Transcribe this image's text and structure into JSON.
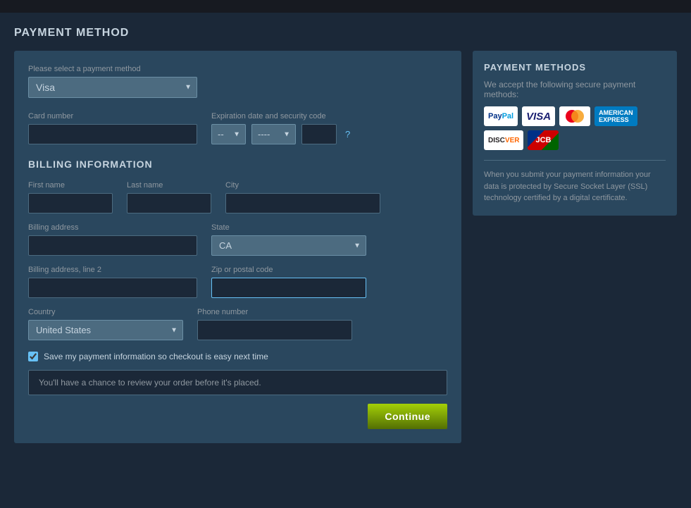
{
  "page": {
    "title": "PAYMENT METHOD",
    "top_bar_color": "#171a21"
  },
  "payment_method": {
    "label": "Please select a payment method",
    "options": [
      "Visa",
      "Mastercard",
      "PayPal",
      "American Express",
      "Discover"
    ],
    "selected": "Visa"
  },
  "card_fields": {
    "card_number_label": "Card number",
    "card_number_placeholder": "",
    "expiry_label": "Expiration date and security code",
    "expiry_month_default": "--",
    "expiry_year_default": "----",
    "cvv_placeholder": "",
    "cvv_hint": "?"
  },
  "billing": {
    "section_title": "BILLING INFORMATION",
    "first_name_label": "First name",
    "last_name_label": "Last name",
    "city_label": "City",
    "billing_address_label": "Billing address",
    "state_label": "State",
    "state_value": "CA",
    "billing_address2_label": "Billing address, line 2",
    "zip_label": "Zip or postal code",
    "country_label": "Country",
    "country_value": "United States",
    "phone_label": "Phone number"
  },
  "footer": {
    "save_checkbox_label": "Save my payment information so checkout is easy next time",
    "review_notice": "You'll have a chance to review your order before it's placed.",
    "continue_button": "Continue"
  },
  "right_panel": {
    "title": "PAYMENT METHODS",
    "subtitle": "We accept the following secure payment methods:",
    "ssl_text": "When you submit your payment information your data is protected by Secure Socket Layer (SSL) technology certified by a digital certificate.",
    "icons": [
      {
        "name": "PayPal",
        "style": "paypal"
      },
      {
        "name": "VISA",
        "style": "visa"
      },
      {
        "name": "MC",
        "style": "mastercard"
      },
      {
        "name": "AMEX",
        "style": "amex"
      },
      {
        "name": "DISC",
        "style": "discover"
      },
      {
        "name": "JCB",
        "style": "jcb"
      }
    ]
  }
}
